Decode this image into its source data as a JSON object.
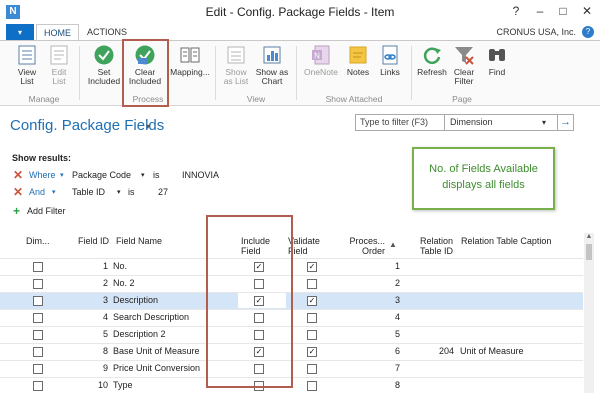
{
  "window": {
    "title": "Edit - Config. Package Fields - Item",
    "app_icon": "N",
    "controls": {
      "help": "?",
      "minimize": "–",
      "maximize": "□",
      "close": "✕"
    }
  },
  "ribbon_tabs": {
    "menu_glyph": "▾",
    "tabs": [
      {
        "label": "HOME",
        "active": true
      },
      {
        "label": "ACTIONS",
        "active": false
      }
    ],
    "company": "CRONUS USA, Inc.",
    "help": "?"
  },
  "ribbon": {
    "buttons": [
      {
        "label1": "View",
        "label2": "List",
        "icon": "view-list-icon",
        "enabled": true
      },
      {
        "label1": "Edit",
        "label2": "List",
        "icon": "edit-list-icon",
        "enabled": false
      },
      {
        "label1": "Set",
        "label2": "Included",
        "icon": "set-included-icon",
        "enabled": true
      },
      {
        "label1": "Clear",
        "label2": "Included",
        "icon": "clear-included-icon",
        "enabled": true
      },
      {
        "label1": "Mapping...",
        "label2": "",
        "icon": "mapping-icon",
        "enabled": true
      },
      {
        "label1": "Show",
        "label2": "as List",
        "icon": "show-as-list-icon",
        "enabled": false
      },
      {
        "label1": "Show as",
        "label2": "Chart",
        "icon": "show-as-chart-icon",
        "enabled": true
      },
      {
        "label1": "OneNote",
        "label2": "",
        "icon": "onenote-icon",
        "enabled": false
      },
      {
        "label1": "Notes",
        "label2": "",
        "icon": "notes-icon",
        "enabled": true
      },
      {
        "label1": "Links",
        "label2": "",
        "icon": "links-icon",
        "enabled": true
      },
      {
        "label1": "Refresh",
        "label2": "",
        "icon": "refresh-icon",
        "enabled": true
      },
      {
        "label1": "Clear",
        "label2": "Filter",
        "icon": "clear-filter-icon",
        "enabled": true
      },
      {
        "label1": "Find",
        "label2": "",
        "icon": "find-icon",
        "enabled": true
      }
    ],
    "groups": [
      "Manage",
      "Process",
      "View",
      "Show Attached",
      "Page"
    ]
  },
  "page": {
    "title": "Config. Package Fields",
    "title_caret": "▾",
    "filter": {
      "placeholder": "Type to filter (F3)",
      "field": "Dimension",
      "caret": "▾",
      "go": "→"
    }
  },
  "filters": {
    "heading": "Show results:",
    "rows": [
      {
        "keyword": "Where",
        "field": "Package Code",
        "operator": "is",
        "value": "INNOVIA"
      },
      {
        "keyword": "And",
        "field": "Table ID",
        "operator": "is",
        "value": "27"
      }
    ],
    "add_label": "Add Filter",
    "remove_glyph": "✕",
    "add_glyph": "+",
    "caret": "▾"
  },
  "annotation": {
    "line1": "No. of Fields Available",
    "line2": "displays all fields"
  },
  "grid": {
    "columns": {
      "dim": "Dim...",
      "field_id": "Field ID",
      "field_name": "Field Name",
      "include_1": "Include",
      "include_2": "Field",
      "validate_1": "Validate",
      "validate_2": "Field",
      "order_1": "Proces...",
      "order_2": "Order",
      "rel_id_1": "Relation",
      "rel_id_2": "Table ID",
      "rel_caption": "Relation Table Caption"
    },
    "sort_glyph": "▲",
    "rows": [
      {
        "field_id": "1",
        "field_name": "No.",
        "include": true,
        "validate": true,
        "order": "1",
        "rel_id": "",
        "rel_caption": "",
        "selected": false
      },
      {
        "field_id": "2",
        "field_name": "No. 2",
        "include": false,
        "validate": false,
        "order": "2",
        "rel_id": "",
        "rel_caption": "",
        "selected": false
      },
      {
        "field_id": "3",
        "field_name": "Description",
        "include": true,
        "validate": true,
        "order": "3",
        "rel_id": "",
        "rel_caption": "",
        "selected": true
      },
      {
        "field_id": "4",
        "field_name": "Search Description",
        "include": false,
        "validate": false,
        "order": "4",
        "rel_id": "",
        "rel_caption": "",
        "selected": false
      },
      {
        "field_id": "5",
        "field_name": "Description 2",
        "include": false,
        "validate": false,
        "order": "5",
        "rel_id": "",
        "rel_caption": "",
        "selected": false
      },
      {
        "field_id": "8",
        "field_name": "Base Unit of Measure",
        "include": true,
        "validate": true,
        "order": "6",
        "rel_id": "204",
        "rel_caption": "Unit of Measure",
        "selected": false
      },
      {
        "field_id": "9",
        "field_name": "Price Unit Conversion",
        "include": false,
        "validate": false,
        "order": "7",
        "rel_id": "",
        "rel_caption": "",
        "selected": false
      },
      {
        "field_id": "10",
        "field_name": "Type",
        "include": false,
        "validate": false,
        "order": "8",
        "rel_id": "",
        "rel_caption": "",
        "selected": false
      }
    ]
  },
  "scrollbar": {
    "up_glyph": "▲"
  }
}
